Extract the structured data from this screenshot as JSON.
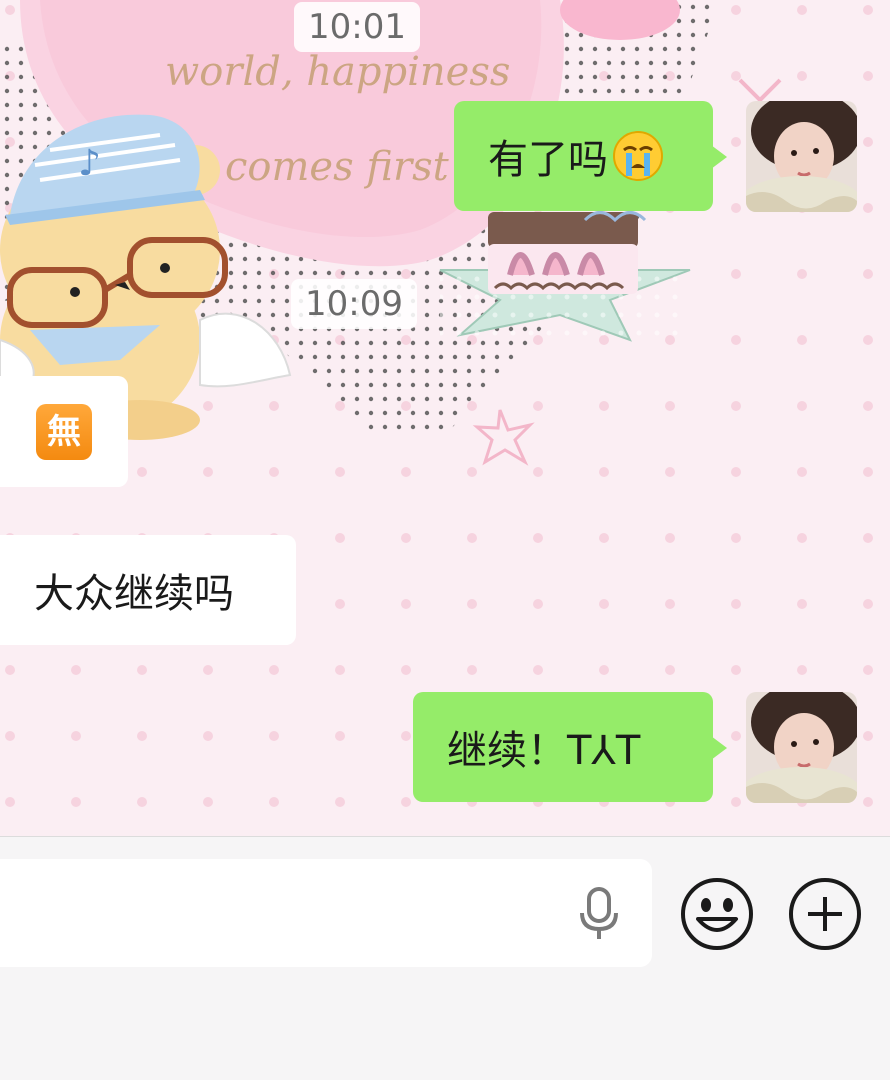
{
  "chat": {
    "time_labels": [
      "10:01",
      "10:09"
    ],
    "messages": [
      {
        "direction": "outgoing",
        "text": "有了吗",
        "emoji": "crying-face"
      },
      {
        "direction": "incoming",
        "sticker": "無",
        "sticker_name": "japanese-free-of-charge-button"
      },
      {
        "direction": "incoming",
        "text": "大众继续吗"
      },
      {
        "direction": "outgoing",
        "text": "继续！T⅄T"
      }
    ]
  },
  "wallpaper": {
    "caption": "world, happiness comes first"
  },
  "input_bar": {
    "value": "",
    "icons": [
      "microphone-icon",
      "emoji-icon",
      "plus-icon"
    ]
  },
  "colors": {
    "outgoing_bubble": "#95ec69",
    "incoming_bubble": "#ffffff",
    "wallpaper_bg": "#fbeef3",
    "input_bar_bg": "#f6f5f6"
  }
}
